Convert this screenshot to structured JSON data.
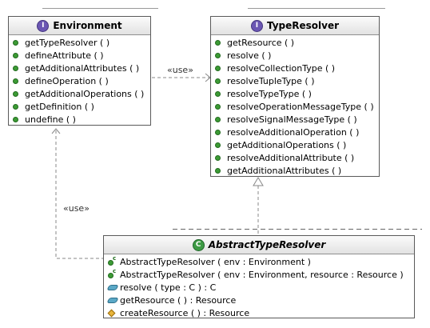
{
  "environment": {
    "stereotype_badge": "I",
    "name": "Environment",
    "methods": [
      "getTypeResolver ( )",
      "defineAttribute ( )",
      "getAdditionalAttributes ( )",
      "defineOperation ( )",
      "getAdditionalOperations ( )",
      "getDefinition ( )",
      "undefine ( )"
    ]
  },
  "type_resolver": {
    "stereotype_badge": "I",
    "name": "TypeResolver",
    "methods": [
      "getResource ( )",
      "resolve ( )",
      "resolveCollectionType ( )",
      "resolveTupleType ( )",
      "resolveTypeType ( )",
      "resolveOperationMessageType ( )",
      "resolveSignalMessageType ( )",
      "resolveAdditionalOperation ( )",
      "getAdditionalOperations ( )",
      "resolveAdditionalAttribute ( )",
      "getAdditionalAttributes ( )"
    ]
  },
  "abstract_type_resolver": {
    "stereotype_badge": "C",
    "name": "AbstractTypeResolver",
    "members": [
      {
        "icon": "constructor-icon",
        "text": "AbstractTypeResolver ( env : Environment )"
      },
      {
        "icon": "constructor-icon",
        "text": "AbstractTypeResolver ( env : Environment, resource : Resource )"
      },
      {
        "icon": "public-method-icon",
        "text": "resolve ( type : C ) : C"
      },
      {
        "icon": "public-method-icon",
        "text": "getResource ( ) : Resource"
      },
      {
        "icon": "protected-method-icon",
        "text": "createResource ( ) : Resource"
      }
    ]
  },
  "relations": {
    "use_label_1": "«use»",
    "use_label_2": "«use»"
  },
  "colors": {
    "interface_badge": "#6b57b3",
    "class_badge": "#3d9b44",
    "method_dot": "#3c9b35"
  }
}
